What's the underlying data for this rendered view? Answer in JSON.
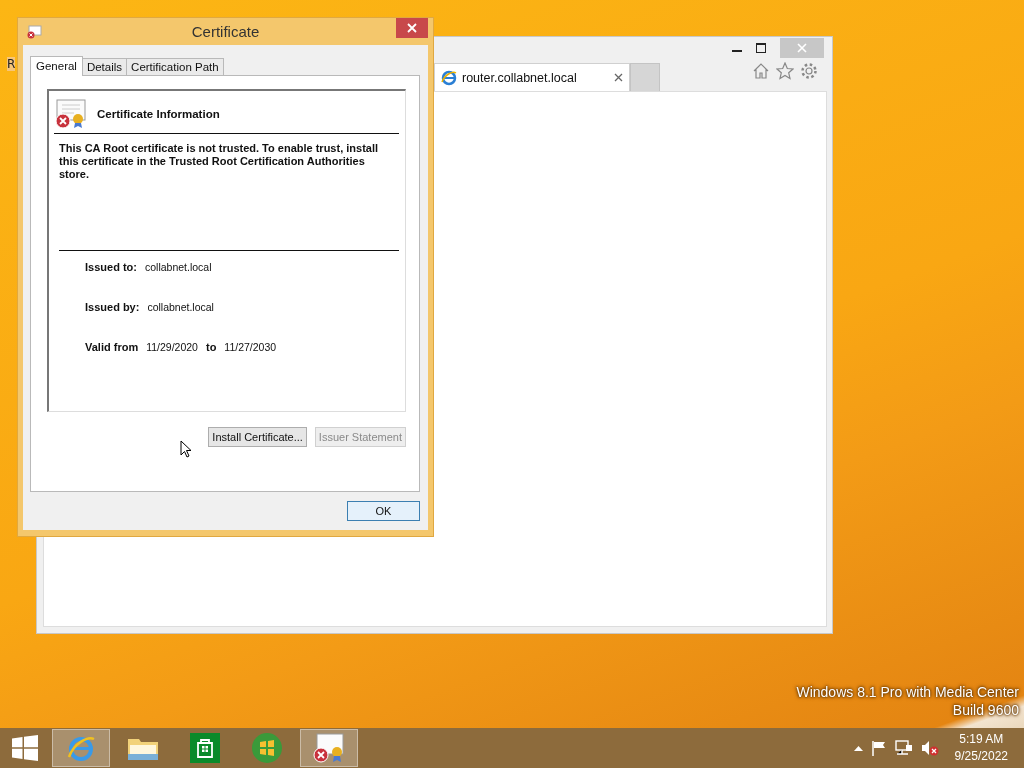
{
  "desktop": {
    "icon_label": "R",
    "watermark": [
      "Windows 8.1 Pro with Media Center",
      "Build 9600"
    ]
  },
  "browser": {
    "tab": {
      "title": "router.collabnet.local",
      "selected": true
    }
  },
  "dialog": {
    "title": "Certificate",
    "tabs": [
      {
        "label": "General",
        "selected": true
      },
      {
        "label": "Details",
        "selected": false
      },
      {
        "label": "Certification Path",
        "selected": false
      }
    ],
    "heading": "Certificate Information",
    "message": "This CA Root certificate is not trusted. To enable trust, install this certificate in the Trusted Root Certification Authorities store.",
    "fields": [
      {
        "label": "Issued to:",
        "value": "collabnet.local"
      },
      {
        "label": "Issued by:",
        "value": "collabnet.local"
      }
    ],
    "validity": {
      "label": "Valid from",
      "from": "11/29/2020",
      "to_label": "to",
      "to": "11/27/2030"
    },
    "buttons": [
      {
        "label": "Install Certificate...",
        "disabled": false
      },
      {
        "label": "Issuer Statement",
        "disabled": true
      }
    ],
    "ok": "OK"
  },
  "taskbar": {
    "apps": [
      {
        "kind": "browser",
        "running": true
      },
      {
        "kind": "folder",
        "running": false
      },
      {
        "kind": "store",
        "running": false
      },
      {
        "kind": "media",
        "running": false
      },
      {
        "kind": "certificate",
        "running": true
      }
    ],
    "time": "5:19 AM",
    "date": "9/25/2022"
  }
}
